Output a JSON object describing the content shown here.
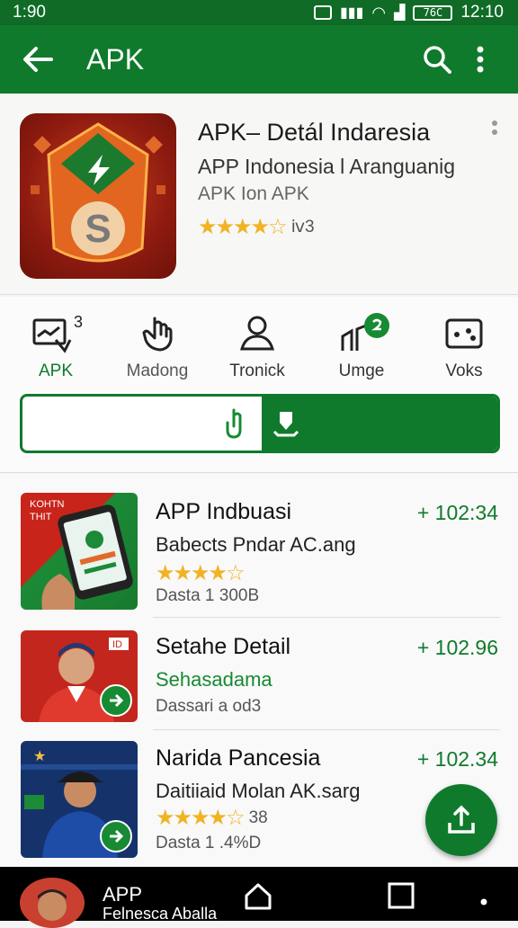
{
  "status_bar": {
    "time": "1:90",
    "battery": "76C",
    "clock": "12:10"
  },
  "app_bar": {
    "title": "APK"
  },
  "hero": {
    "title": "APK– Detál Indaresia",
    "subtitle": "APP Indonesia l Aranguanig",
    "subtitle2": "APK Ion APK",
    "stars": "★★★★☆",
    "rating_text": "ⅳ3"
  },
  "categories": [
    {
      "label": "APK",
      "badge": "3"
    },
    {
      "label": "Madong"
    },
    {
      "label": "Tronick"
    },
    {
      "label": "Umge"
    },
    {
      "label": "Voks"
    }
  ],
  "list": [
    {
      "name": "APP Indbuasi",
      "sub": "Babects Pndar AC.ang",
      "stars": "★★★★☆",
      "meta": "Dasta 1 300B",
      "price": "+ 102:34",
      "thumb_text": "KOHTN\nTHIT"
    },
    {
      "name": "Setahe Detail",
      "sub": "Sehasadama",
      "meta": "Dassari a od3",
      "price": "+ 102.96",
      "thumb_badge": "ID"
    },
    {
      "name": "Narida Pancesia",
      "sub": "Daitiiaid Molan AK.sarg",
      "stars": "★★★★☆",
      "rating_text": "38",
      "meta": "Dasta 1 .4%D",
      "price": "+ 102.34"
    }
  ],
  "nav": {
    "title": "APP",
    "subtitle": "Felnesca Aballa"
  },
  "colors": {
    "primary": "#0f7a2c",
    "dark": "#0f6b26",
    "star": "#f0b323"
  }
}
